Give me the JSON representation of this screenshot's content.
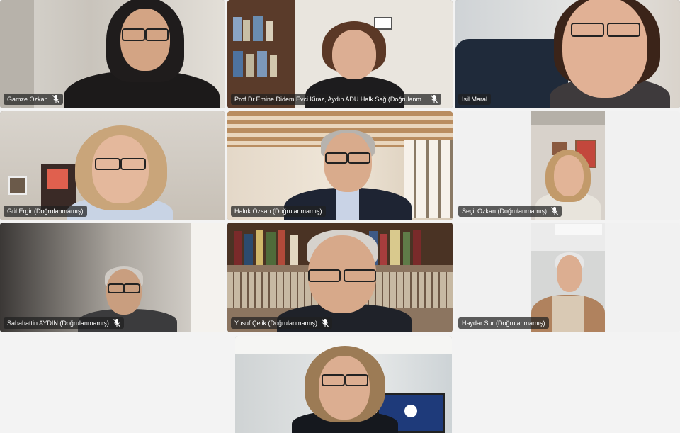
{
  "participants": [
    {
      "name": "Gamze Ozkan"
    },
    {
      "name": "Prof.Dr.Emine Didem Evci Kiraz, Aydın ADÜ Halk Sağ (Doğrulanm..."
    },
    {
      "name": "Isil Maral"
    },
    {
      "name": "Gül Ergir (Doğrulanmamış)"
    },
    {
      "name": "Haluk Özsan (Doğrulanmamış)"
    },
    {
      "name": "Seçil Ozkan (Doğrulanmamış)"
    },
    {
      "name": "Sabahattin AYDIN (Doğrulanmamış)"
    },
    {
      "name": "Yusuf Çelik (Doğrulanmamış)"
    },
    {
      "name": "Haydar Sur (Doğrulanmamış)"
    },
    {
      "name": ""
    }
  ],
  "icons": {
    "muted": "microphone-muted-icon"
  },
  "colors": {
    "background": "#f3f3f3",
    "name_tag": "#202020",
    "tile_border": "#ffffff"
  }
}
